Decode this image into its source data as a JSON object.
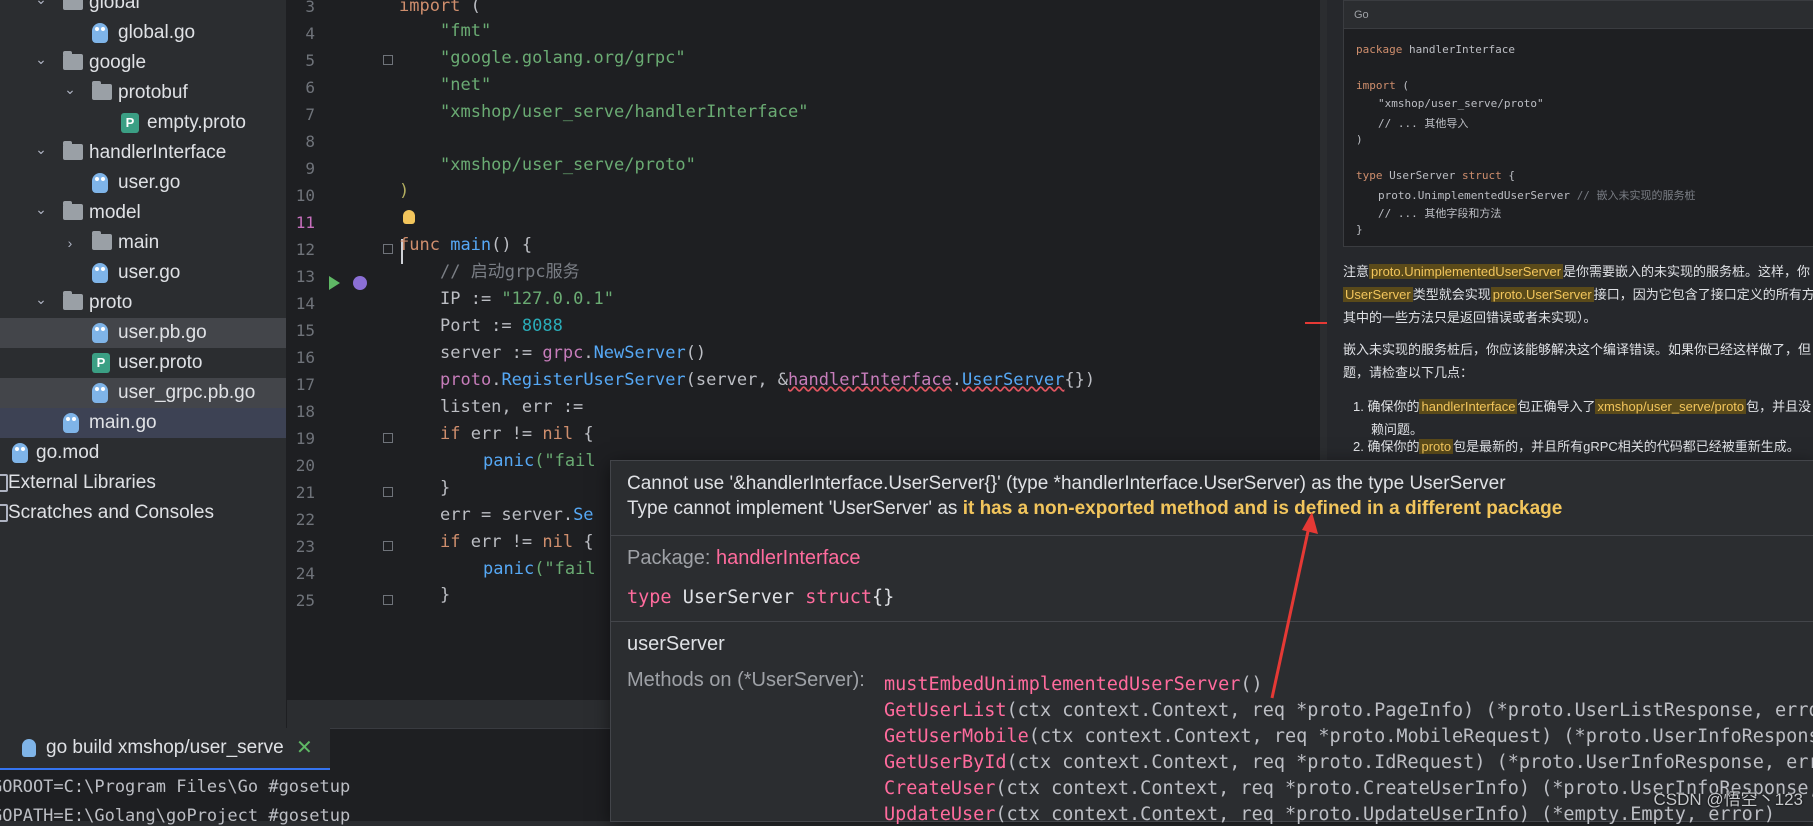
{
  "project_tree": {
    "items": [
      {
        "label": "global",
        "kind": "folder",
        "depth": 1,
        "expanded": true
      },
      {
        "label": "global.go",
        "kind": "go",
        "depth": 2
      },
      {
        "label": "google",
        "kind": "folder",
        "depth": 1,
        "expanded": true
      },
      {
        "label": "protobuf",
        "kind": "folder",
        "depth": 2,
        "expanded": true
      },
      {
        "label": "empty.proto",
        "kind": "proto",
        "depth": 3
      },
      {
        "label": "handlerInterface",
        "kind": "folder",
        "depth": 1,
        "expanded": true
      },
      {
        "label": "user.go",
        "kind": "go",
        "depth": 2
      },
      {
        "label": "model",
        "kind": "folder",
        "depth": 1,
        "expanded": true
      },
      {
        "label": "main",
        "kind": "folder",
        "depth": 2,
        "expanded": false
      },
      {
        "label": "user.go",
        "kind": "go",
        "depth": 2
      },
      {
        "label": "proto",
        "kind": "folder",
        "depth": 1,
        "expanded": true
      },
      {
        "label": "user.pb.go",
        "kind": "go",
        "depth": 2
      },
      {
        "label": "user.proto",
        "kind": "proto",
        "depth": 2
      },
      {
        "label": "user_grpc.pb.go",
        "kind": "go",
        "depth": 2
      },
      {
        "label": "main.go",
        "kind": "go",
        "depth": 1
      },
      {
        "label": "go.mod",
        "kind": "gomod",
        "depth": 0
      },
      {
        "label": "External Libraries",
        "kind": "lib",
        "depth": 0
      },
      {
        "label": "Scratches and Consoles",
        "kind": "scratch",
        "depth": 0
      }
    ]
  },
  "editor": {
    "line_numbers": [
      "3",
      "4",
      "5",
      "6",
      "7",
      "8",
      "9",
      "10",
      "11",
      "12",
      "13",
      "14",
      "15",
      "16",
      "17",
      "18",
      "19",
      "20",
      "21",
      "22",
      "23",
      "24",
      "25"
    ],
    "current_line": "11",
    "code": {
      "l3_kw": "import",
      "l3_rest": " (",
      "l4": "\"fmt\"",
      "l5": "\"google.golang.org/grpc\"",
      "l6": "\"net\"",
      "l7": "\"xmshop/user_serve/handlerInterface\"",
      "l9": "\"xmshop/user_serve/proto\"",
      "l10": ")",
      "l12_kw": "func",
      "l12_fn": "main",
      "l12_rest": "() {",
      "l13": "// 启动grpc服务",
      "l14_a": "IP := ",
      "l14_b": "\"127.0.0.1\"",
      "l15_a": "Port := ",
      "l15_b": "8088",
      "l16_a": "server := ",
      "l16_pkg": "grpc",
      "l16_dot": ".",
      "l16_fn": "NewServer",
      "l16_rest": "()",
      "l17_pkg": "proto",
      "l17_dot": ".",
      "l17_fn": "RegisterUserServer",
      "l17_a": "(server, &",
      "l17_pkg2": "handlerInterface",
      "l17_dot2": ".",
      "l17_ty": "UserServer",
      "l17_rest": "{})",
      "l18": "listen, err := ",
      "l19_kw": "if",
      "l19_rest": " err != ",
      "l19_kw2": "nil",
      "l19_end": " {",
      "l20_fn": "panic",
      "l20_rest": "(\"fail",
      "l21": "}",
      "l22_a": "err = server.",
      "l22_fn": "Se",
      "l23_kw": "if",
      "l23_rest": " err != ",
      "l23_kw2": "nil",
      "l23_end": " {",
      "l24_fn": "panic",
      "l24_rest": "(\"fail",
      "l25": "}"
    }
  },
  "chat": {
    "code_lang": "Go",
    "code_lines": [
      {
        "kw": "package",
        "rest": " handlerInterface"
      },
      {
        "kw": "import",
        "rest": " ("
      },
      {
        "str": "\"xmshop/user_serve/proto\""
      },
      {
        "cm": "// ... 其他导入"
      },
      {
        "plain": ")"
      },
      {
        "kw": "type",
        "rest": " UserServer ",
        "kw2": "struct",
        "end": " {"
      },
      {
        "plain": "proto.UnimplementedUserServer ",
        "cm": "// 嵌入未实现的服务桩"
      },
      {
        "cm": "// ... 其他字段和方法"
      },
      {
        "plain": "}"
      }
    ],
    "p1_a": "注意",
    "p1_hl1": "proto.UnimplementedUserServer",
    "p1_b": "是你需要嵌入的未实现的服务桩。这样，你",
    "p1_hl2": "UserServer",
    "p1_c": "类型就会实现",
    "p1_hl3": "proto.UserServer",
    "p1_d": "接口，因为它包含了接口定义的所有方",
    "p1_e": "其中的一些方法只是返回错误或者未实现）。",
    "p2_a": "嵌入未实现的服务桩后，你应该能够解决这个编译错误。如果你已经这样做了，但",
    "p2_b": "题，请检查以下几点：",
    "li1_num": "1.",
    "li1_a": "确保你的",
    "li1_hl1": "handlerInterface",
    "li1_b": "包正确导入了",
    "li1_hl2": "xmshop/user_serve/proto",
    "li1_c": "包，并且没",
    "li1_d": "赖问题。",
    "li2_num": "2.",
    "li2_a": "确保你的",
    "li2_hl": "proto",
    "li2_b": "包是最新的，并且所有gRPC相关的代码都已经被重新生成。"
  },
  "tooltip": {
    "error_line1": "Cannot use '&handlerInterface.UserServer{}' (type *handlerInterface.UserServer) as the type UserServer",
    "error_line2_a": "Type cannot implement 'UserServer' as ",
    "error_line2_b": "it has a non-exported method and is defined in a different package",
    "package_label": "Package: ",
    "package_name": "handlerInterface",
    "decl_kw": "type",
    "decl_name": " UserServer ",
    "decl_kw2": "struct",
    "decl_rest": "{}",
    "type_doc": "userServer",
    "methods_label": "Methods on (*UserServer):",
    "methods": [
      {
        "name": "mustEmbedUnimplementedUserServer",
        "sig": "()"
      },
      {
        "name": "GetUserList",
        "sig": "(ctx context.Context, req *proto.PageInfo) (*proto.UserListResponse, error"
      },
      {
        "name": "GetUserMobile",
        "sig": "(ctx context.Context, req *proto.MobileRequest) (*proto.UserInfoResponse"
      },
      {
        "name": "GetUserById",
        "sig": "(ctx context.Context, req *proto.IdRequest) (*proto.UserInfoResponse, erro"
      },
      {
        "name": "CreateUser",
        "sig": "(ctx context.Context, req *proto.CreateUserInfo) (*proto.UserInfoResponse,"
      },
      {
        "name": "UpdateUser",
        "sig": "(ctx context.Context, req *proto.UpdateUserInfo) (*empty.Empty, error)"
      }
    ]
  },
  "run_panel": {
    "tab_label": "go build xmshop/user_serve",
    "lines": [
      "GOROOT=C:\\Program Files\\Go #gosetup",
      "GOPATH=E:\\Golang\\goProject #gosetup"
    ]
  },
  "watermark": "CSDN @悟空丶123"
}
